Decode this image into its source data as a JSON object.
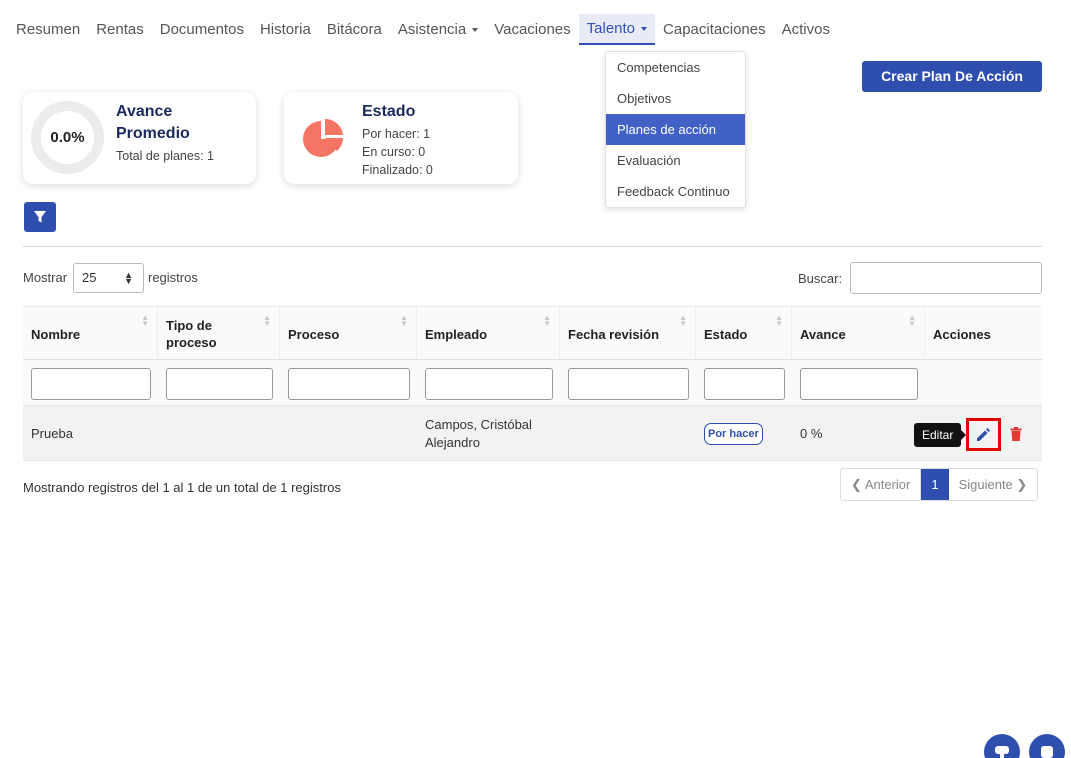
{
  "nav": {
    "items": [
      {
        "label": "Resumen"
      },
      {
        "label": "Rentas"
      },
      {
        "label": "Documentos"
      },
      {
        "label": "Historia"
      },
      {
        "label": "Bitácora"
      },
      {
        "label": "Asistencia"
      },
      {
        "label": "Vacaciones"
      },
      {
        "label": "Talento"
      },
      {
        "label": "Capacitaciones"
      },
      {
        "label": "Activos"
      }
    ],
    "active": "Talento"
  },
  "talento_menu": {
    "items": [
      "Competencias",
      "Objetivos",
      "Planes de acción",
      "Evaluación",
      "Feedback Continuo"
    ],
    "selected": "Planes de acción"
  },
  "create_button": "Crear Plan De Acción",
  "avance_card": {
    "value": "0.0%",
    "title_line1": "Avance",
    "title_line2": "Promedio",
    "total": "Total de planes: 1"
  },
  "estado_card": {
    "title": "Estado",
    "por_hacer": "Por hacer: 1",
    "en_curso": "En curso: 0",
    "finalizado": "Finalizado: 0"
  },
  "table_controls": {
    "show_label": "Mostrar",
    "page_length": "25",
    "records_label": "registros",
    "search_label": "Buscar:"
  },
  "table": {
    "headers": [
      "Nombre",
      "Tipo de proceso",
      "Proceso",
      "Empleado",
      "Fecha revisión",
      "Estado",
      "Avance",
      "Acciones"
    ],
    "header_tipo_line1": "Tipo de",
    "header_tipo_line2": "proceso",
    "row": {
      "nombre": "Prueba",
      "tipo": "",
      "proceso": "",
      "empleado_line1": "Campos, Cristóbal",
      "empleado_line2": "Alejandro",
      "fecha": "",
      "estado": "Por hacer",
      "avance": "0 %"
    }
  },
  "tooltip": "Editar",
  "info": "Mostrando registros del 1 al 1 de un total de 1 registros",
  "pagination": {
    "prev": "Anterior",
    "current": "1",
    "next": "Siguiente"
  },
  "colors": {
    "primary": "#2f4fae",
    "menu_selected": "#4261c7",
    "pie": "#f47564",
    "delete": "#e53935",
    "highlight": "#e00000"
  },
  "icons": {
    "filter": "filter-icon",
    "pie": "pie-chart-icon",
    "edit": "pencil-icon",
    "delete": "trash-icon",
    "chat": "chat-icon",
    "support": "headset-icon"
  }
}
